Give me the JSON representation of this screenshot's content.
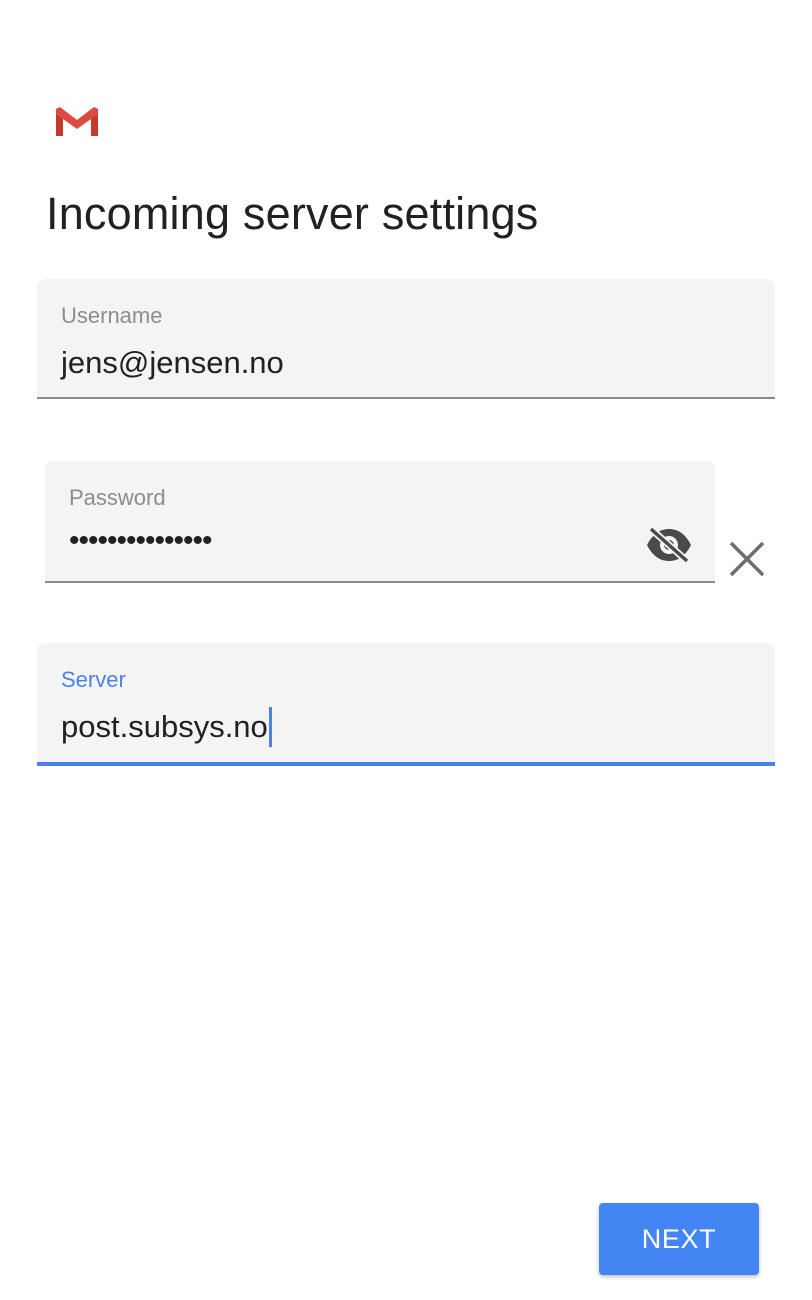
{
  "app": {
    "logo_icon": "gmail-logo-icon",
    "accent_color": "#4285f4"
  },
  "page": {
    "title": "Incoming server settings"
  },
  "username": {
    "label": "Username",
    "value": "jens@jensen.no"
  },
  "password": {
    "label": "Password",
    "value": "•••••••••••••••",
    "visibility_icon": "eye-off-icon",
    "clear_icon": "close-icon"
  },
  "server": {
    "label": "Server",
    "value": "post.subsys.no",
    "focused": true
  },
  "actions": {
    "next_label": "NEXT"
  }
}
